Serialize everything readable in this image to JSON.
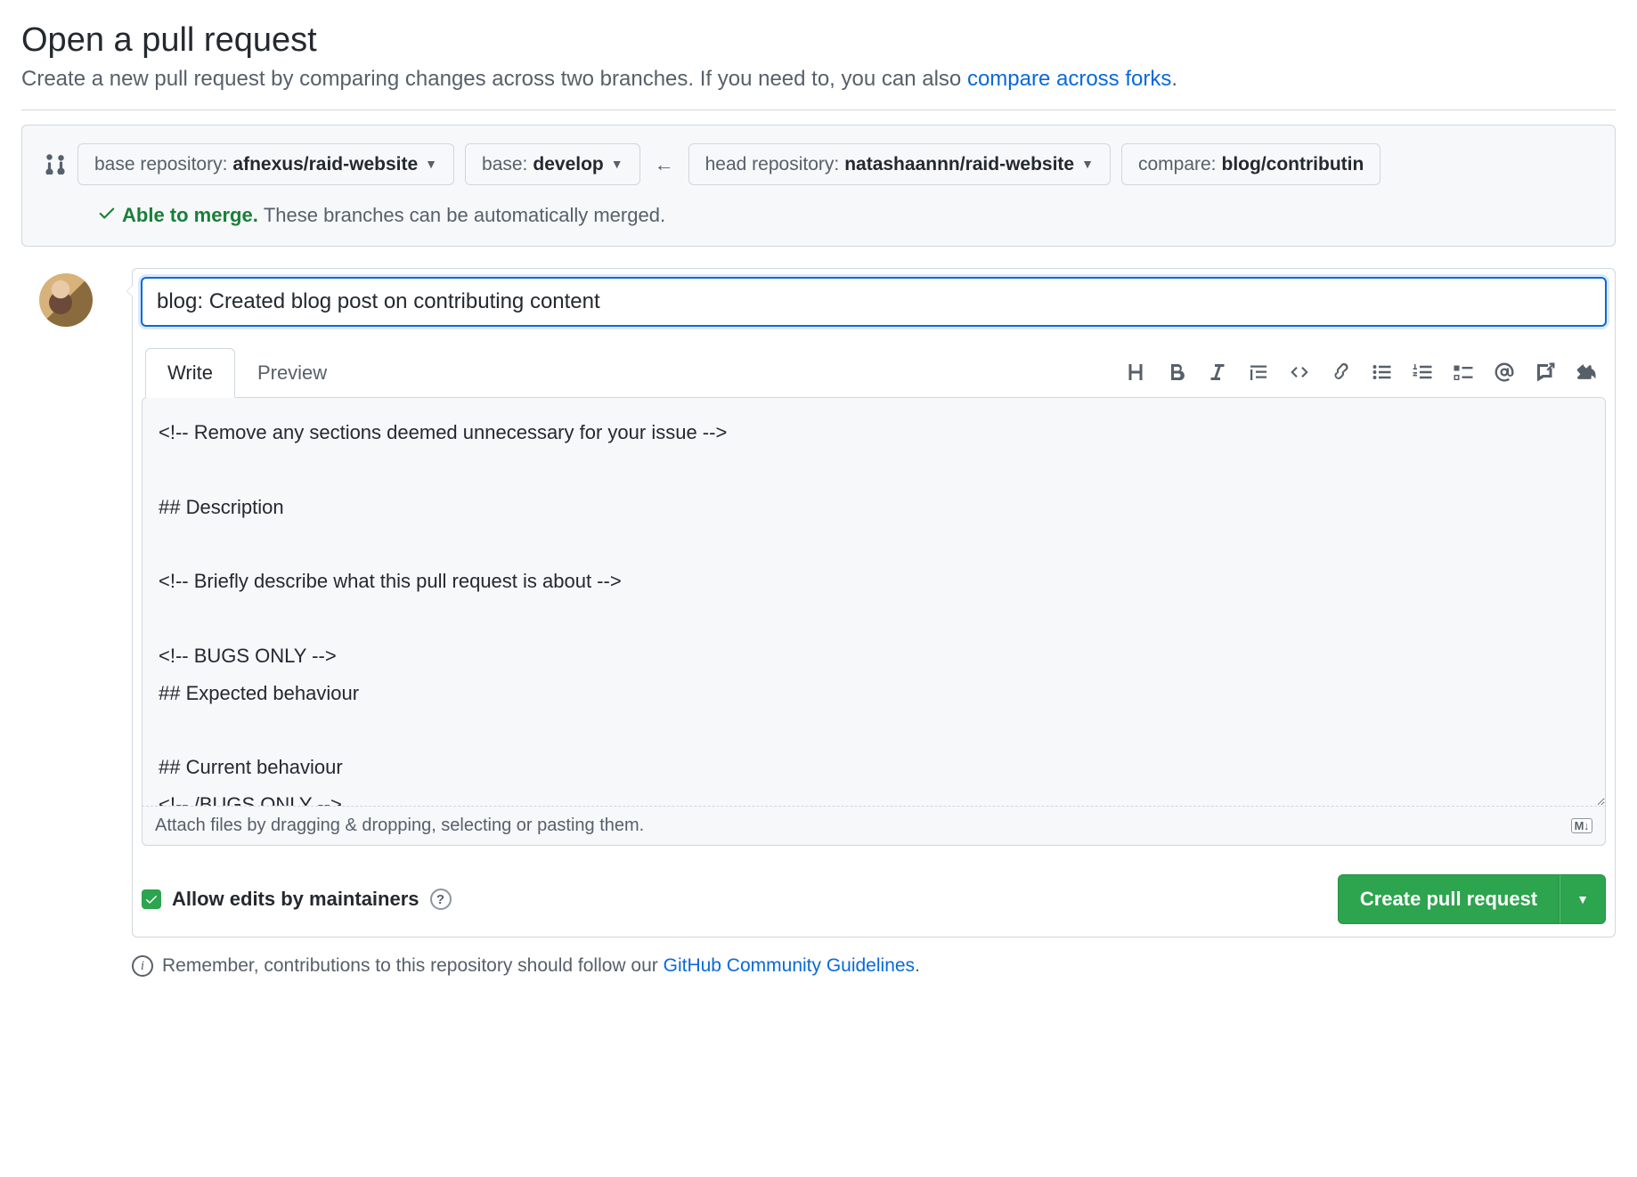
{
  "header": {
    "title": "Open a pull request",
    "subtitle_prefix": "Create a new pull request by comparing changes across two branches. If you need to, you can also ",
    "subtitle_link": "compare across forks",
    "subtitle_suffix": "."
  },
  "compare": {
    "base_repo_label": "base repository: ",
    "base_repo_value": "afnexus/raid-website",
    "base_branch_label": "base: ",
    "base_branch_value": "develop",
    "head_repo_label": "head repository: ",
    "head_repo_value": "natashaannn/raid-website",
    "compare_branch_label": "compare: ",
    "compare_branch_value": "blog/contributin",
    "merge_status_strong": "Able to merge.",
    "merge_status_rest": " These branches can be automatically merged."
  },
  "form": {
    "title_value": "blog: Created blog post on contributing content",
    "tab_write": "Write",
    "tab_preview": "Preview",
    "body_value": "<!-- Remove any sections deemed unnecessary for your issue -->\n\n## Description\n\n<!-- Briefly describe what this pull request is about -->\n\n<!-- BUGS ONLY -->\n## Expected behaviour\n\n## Current behaviour\n<!-- /BUGS ONLY -->",
    "attach_hint": "Attach files by dragging & dropping, selecting or pasting them.",
    "md_badge": "M↓",
    "allow_edits_label": "Allow edits by maintainers",
    "allow_edits_checked": true,
    "submit_label": "Create pull request"
  },
  "toolbar_icons": [
    "heading-icon",
    "bold-icon",
    "italic-icon",
    "quote-icon",
    "code-icon",
    "link-icon",
    "unordered-list-icon",
    "ordered-list-icon",
    "task-list-icon",
    "mention-icon",
    "cross-reference-icon",
    "reply-icon"
  ],
  "footer": {
    "note_prefix": "Remember, contributions to this repository should follow our ",
    "note_link": "GitHub Community Guidelines",
    "note_suffix": "."
  }
}
